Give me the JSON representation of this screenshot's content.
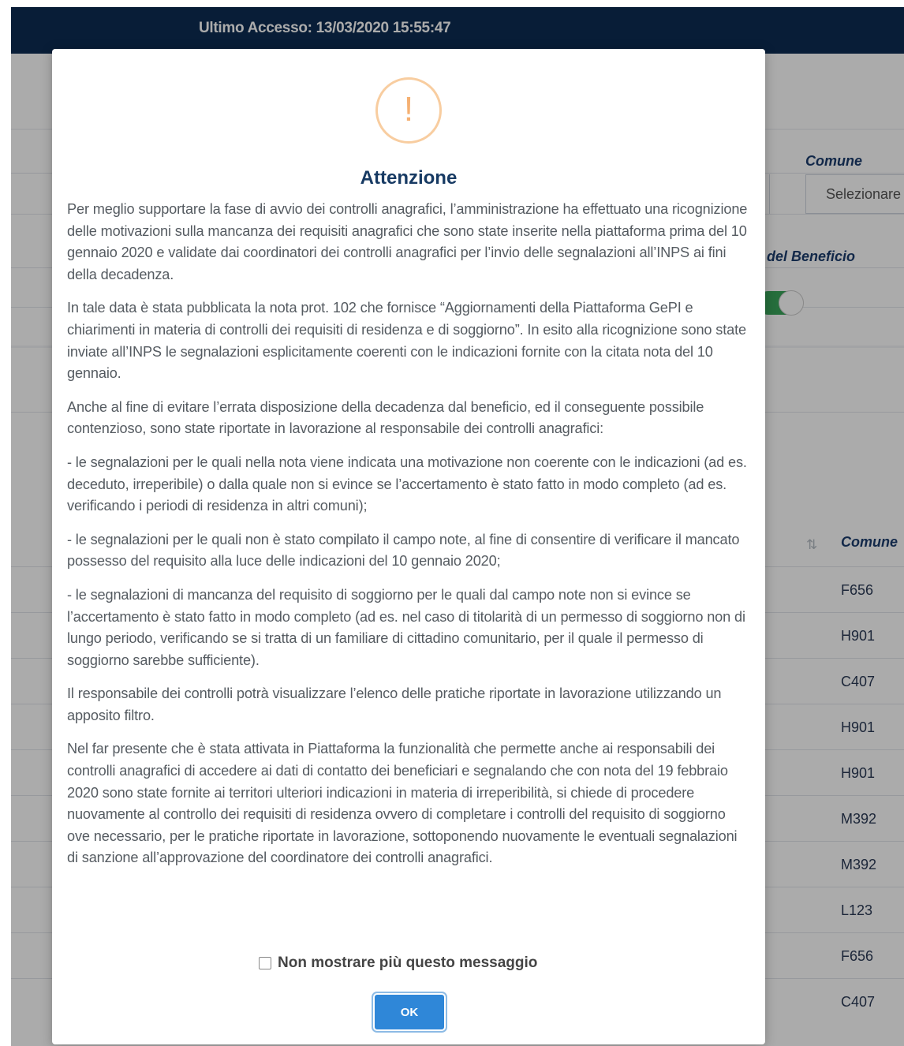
{
  "header": {
    "last_access": "Ultimo Accesso: 13/03/2020 15:55:47"
  },
  "background": {
    "comune_label": "Comune",
    "comune_select_value": "Selezionare",
    "beneficio_label": "del Beneficio",
    "table_header_comune": "Comune",
    "comune_codes": [
      "F656",
      "H901",
      "C407",
      "H901",
      "H901",
      "M392",
      "M392",
      "L123",
      "F656",
      "C407"
    ]
  },
  "modal": {
    "icon_glyph": "!",
    "title": "Attenzione",
    "paragraphs": [
      "Per meglio supportare la fase di avvio dei controlli anagrafici, l’amministrazione ha effettuato una ricognizione delle motivazioni sulla mancanza dei requisiti anagrafici che sono state inserite nella piattaforma prima del 10 gennaio 2020 e validate dai coordinatori dei controlli anagrafici per l’invio delle segnalazioni all’INPS ai fini della decadenza.",
      "In tale data è stata pubblicata la nota prot. 102 che fornisce “Aggiornamenti della Piattaforma GePI e chiarimenti in materia di controlli dei requisiti di residenza e di soggiorno”. In esito alla ricognizione sono state inviate all’INPS le segnalazioni esplicitamente coerenti con le indicazioni fornite con la citata nota del 10 gennaio.",
      "Anche al fine di evitare l’errata disposizione della decadenza dal beneficio, ed il conseguente possibile contenzioso, sono state riportate in lavorazione al responsabile dei controlli anagrafici:",
      "- le segnalazioni per le quali nella nota viene indicata una motivazione non coerente con le indicazioni (ad es. deceduto, irreperibile) o dalla quale non si evince se l’accertamento è stato fatto in modo completo (ad es. verificando i periodi di residenza in altri comuni);",
      "- le segnalazioni per le quali non è stato compilato il campo note, al fine di consentire di verificare il mancato possesso del requisito alla luce delle indicazioni del 10 gennaio 2020;",
      "- le segnalazioni di mancanza del requisito di soggiorno per le quali dal campo note non si evince se l’accertamento è stato fatto in modo completo (ad es. nel caso di titolarità di un permesso di soggiorno non di lungo periodo, verificando se si tratta di un familiare di cittadino comunitario, per il quale il permesso di soggiorno sarebbe sufficiente).",
      "Il responsabile dei controlli potrà visualizzare l’elenco delle pratiche riportate in lavorazione utilizzando un apposito filtro.",
      "Nel far presente che è stata attivata in Piattaforma la funzionalità che permette anche ai responsabili dei controlli anagrafici di accedere ai dati di contatto dei beneficiari e segnalando che con nota del 19 febbraio 2020 sono state fornite ai territori ulteriori indicazioni in materia di irreperibilità, si chiede di procedere nuovamente al controllo dei requisiti di residenza ovvero di completare i controlli del requisito di soggiorno ove necessario, per le pratiche riportate in lavorazione, sottoponendo nuovamente le eventuali segnalazioni di sanzione all’approvazione del coordinatore dei controlli anagrafici."
    ],
    "dont_show_label": "Non mostrare più questo messaggio",
    "ok_label": "OK"
  }
}
